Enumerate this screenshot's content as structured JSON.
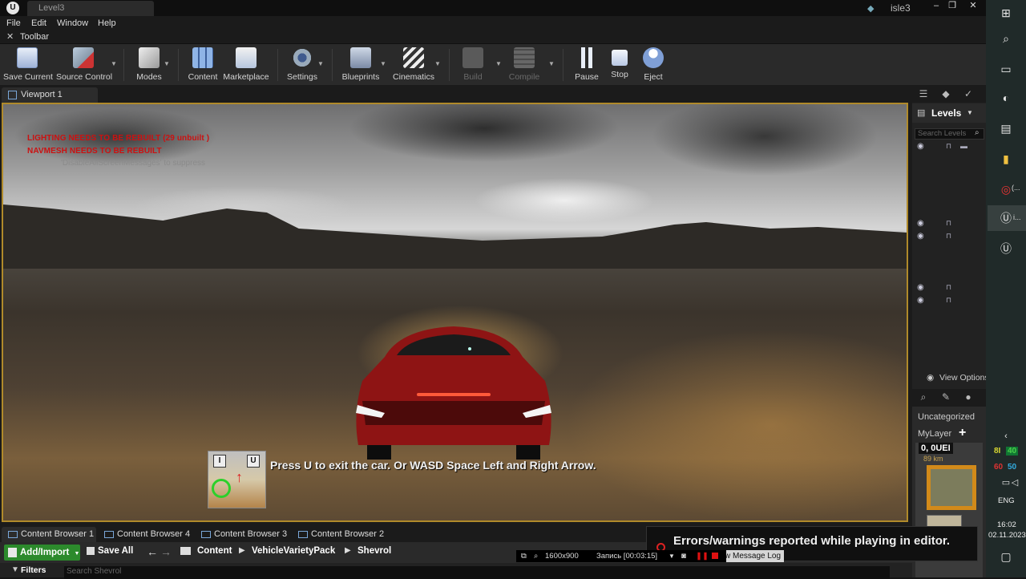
{
  "window": {
    "doc_tab": "Level3",
    "project_name": "isle3",
    "controls": [
      "–",
      "❐",
      "✕"
    ]
  },
  "menu": [
    "File",
    "Edit",
    "Window",
    "Help"
  ],
  "toolbar_tab": "Toolbar",
  "toolbar": {
    "save_current": "Save Current",
    "source_control": "Source Control",
    "modes": "Modes",
    "content": "Content",
    "marketplace": "Marketplace",
    "settings": "Settings",
    "blueprints": "Blueprints",
    "cinematics": "Cinematics",
    "build": "Build",
    "compile": "Compile",
    "pause": "Pause",
    "stop": "Stop",
    "eject": "Eject"
  },
  "viewport": {
    "tab": "Viewport 1",
    "warnings": [
      "LIGHTING NEEDS TO BE REBUILT (29 unbuilt )",
      "NAVMESH NEEDS TO BE REBUILT"
    ],
    "suppress_hint": "'DisableAllScreenMessages' to suppress",
    "hint_text": "Press U to exit the car. Or WASD Space Left and Right Arrow.",
    "hint_keys": [
      "I",
      "U"
    ]
  },
  "levels_panel": {
    "title": "Levels",
    "search_placeholder": "Search Levels",
    "view_options": "View Options"
  },
  "layers_panel": {
    "items": [
      "Uncategorized",
      "MyLayer"
    ],
    "add": "+"
  },
  "minimap": {
    "gear": "0, 0UEI",
    "distance": "89 km"
  },
  "content_browser": {
    "tabs": [
      "Content Browser 1",
      "Content Browser 4",
      "Content Browser 3",
      "Content Browser 2"
    ],
    "add_import": "Add/Import",
    "save_all": "Save All",
    "breadcrumb": [
      "Content",
      "VehicleVarietyPack",
      "Shevrol"
    ],
    "filters": "Filters",
    "search_placeholder": "Search Shevrol"
  },
  "error_toast": {
    "text": "Errors/warnings reported while playing in editor.",
    "message_log": "w Message Log"
  },
  "recording": {
    "resolution": "1600x900",
    "timer": "Запись [00:03:15]"
  },
  "tray": {
    "temp1_label": "8I",
    "temp1_value": "40",
    "temp2_label": "60",
    "temp2_value": "50",
    "lang": "ENG",
    "time": "16:02",
    "date": "02.11.2023",
    "pinned": [
      "(...",
      "i..."
    ]
  },
  "colors": {
    "accent_green": "#2c8a2c",
    "viewport_border": "#b08a2a",
    "warning_red": "#cc1111"
  }
}
